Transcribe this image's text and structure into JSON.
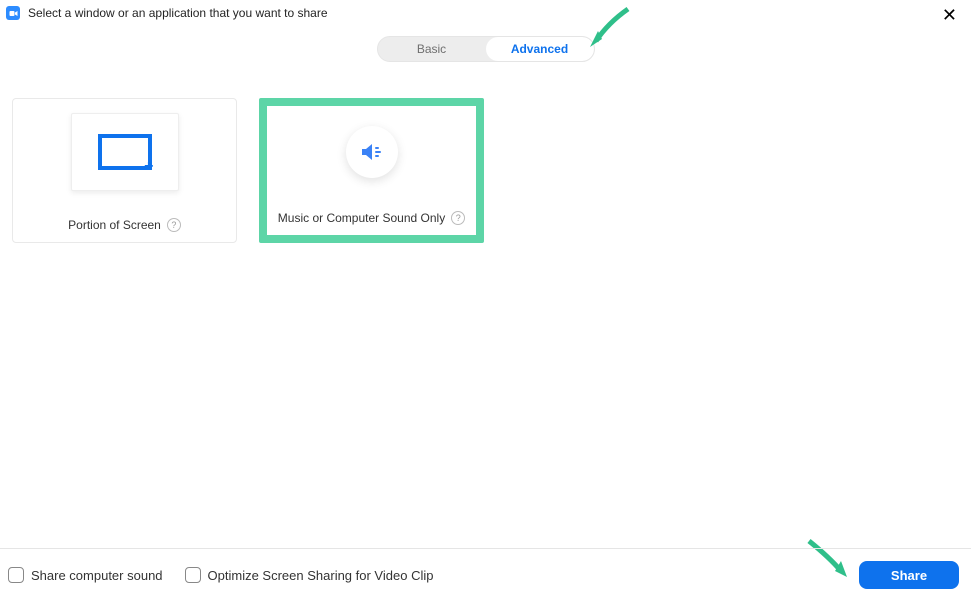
{
  "header": {
    "title": "Select a window or an application that you want to share"
  },
  "tabs": {
    "basic": "Basic",
    "advanced": "Advanced"
  },
  "options": {
    "portion": {
      "label": "Portion of Screen"
    },
    "music": {
      "label": "Music or Computer Sound Only"
    }
  },
  "footer": {
    "share_sound": "Share computer sound",
    "optimize": "Optimize Screen Sharing for Video Clip",
    "share_button": "Share"
  }
}
